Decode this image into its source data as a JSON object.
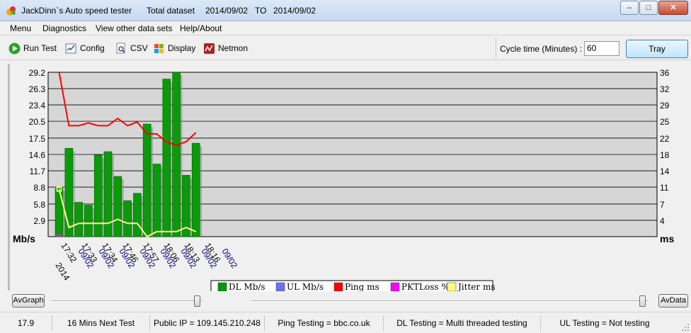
{
  "window": {
    "title_app": "JackDinn`s Auto speed tester",
    "title_dataset": "Total dataset",
    "title_from": "2014/09/02",
    "title_to_label": "TO",
    "title_to": "2014/09/02",
    "min_glyph": "–",
    "max_glyph": "□",
    "close_glyph": "✕"
  },
  "menu": [
    "Menu",
    "Diagnostics",
    "View other data sets",
    "Help/About"
  ],
  "toolbar": {
    "run_test": "Run Test",
    "config": "Config",
    "csv": "CSV",
    "display": "Display",
    "netmon": "Netmon",
    "cycle_label": "Cycle time (Minutes) :",
    "cycle_value": "60",
    "tray": "Tray"
  },
  "chart_data": {
    "type": "bar",
    "left_unit": "Mb/s",
    "right_unit": "ms",
    "year_label": "2014",
    "left_ticks": [
      "29.2",
      "26.3",
      "23.4",
      "20.5",
      "17.5",
      "14.6",
      "11.7",
      "8.8",
      "5.8",
      "2.9"
    ],
    "right_ticks": [
      "36",
      "32",
      "29",
      "25",
      "22",
      "18",
      "14",
      "11",
      "7",
      "4"
    ],
    "ylim_left": [
      0,
      29.2
    ],
    "ylim_right": [
      0,
      36
    ],
    "time_labels": [
      "17:32",
      "17:33",
      "17:34",
      "17:46",
      "17:57",
      "18:06",
      "18:13",
      "18:16"
    ],
    "date_labels": [
      "09/02",
      "09/02",
      "09/02",
      "09/02",
      "09/02",
      "09/02",
      "09/02",
      "09/02"
    ],
    "dl_values": [
      8.6,
      15.7,
      6.1,
      5.6,
      14.5,
      15.1,
      10.7,
      6.4,
      7.7,
      20.0,
      12.9,
      28.0,
      29.2,
      10.9,
      16.6
    ],
    "ping_values": [
      36.0,
      24.3,
      24.3,
      24.9,
      24.3,
      24.3,
      25.9,
      24.3,
      25.1,
      22.5,
      22.5,
      20.7,
      20.0,
      20.8,
      22.8
    ],
    "jitter_values": [
      10.4,
      2.0,
      2.9,
      2.9,
      2.9,
      2.9,
      3.8,
      2.9,
      2.9,
      0.0,
      1.1,
      1.1,
      1.1,
      2.0,
      1.1
    ],
    "pktloss_values": [
      0.2
    ],
    "series": [
      {
        "name": "DL Mb/s",
        "color": "#009900"
      },
      {
        "name": "UL Mb/s",
        "color": "#7070ff"
      },
      {
        "name": "Ping ms",
        "color": "#ff0000"
      },
      {
        "name": "PKTLoss %",
        "color": "#ff00ff"
      },
      {
        "name": "Jitter ms",
        "color": "#ffff80"
      }
    ],
    "grid": true,
    "legend_placement": "bottom-center"
  },
  "controls": {
    "avgraph": "AvGraph",
    "avdata": "AvData"
  },
  "status": {
    "latest_dl": "17.9",
    "next_test": "16 Mins Next Test",
    "public_ip": "Public IP = 109.145.210.248",
    "ping_testing": "Ping Testing = bbc.co.uk",
    "dl_testing": "DL Testing = Multi threaded testing",
    "ul_testing": "UL Testing = Not testing"
  }
}
